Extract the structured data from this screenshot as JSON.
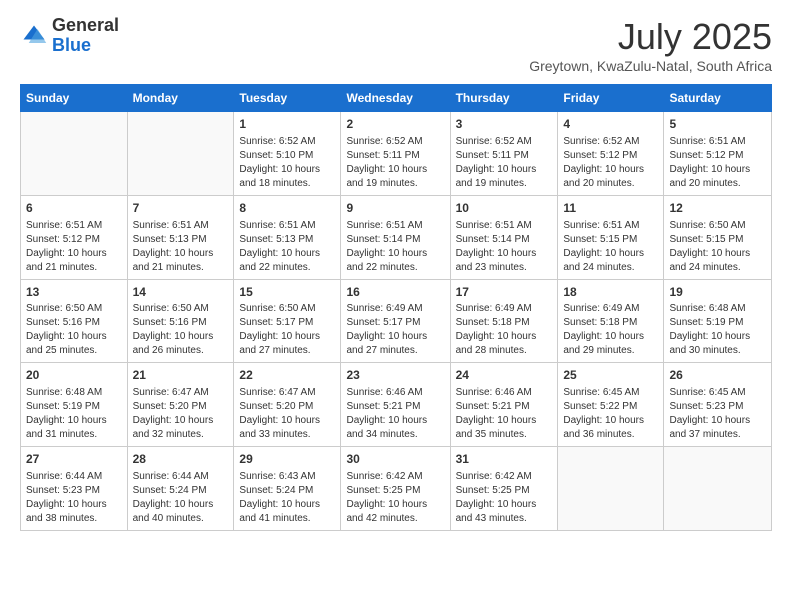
{
  "header": {
    "logo": {
      "general": "General",
      "blue": "Blue"
    },
    "title": "July 2025",
    "location": "Greytown, KwaZulu-Natal, South Africa"
  },
  "calendar": {
    "columns": [
      "Sunday",
      "Monday",
      "Tuesday",
      "Wednesday",
      "Thursday",
      "Friday",
      "Saturday"
    ],
    "rows": [
      [
        {
          "day": "",
          "info": ""
        },
        {
          "day": "",
          "info": ""
        },
        {
          "day": "1",
          "info": "Sunrise: 6:52 AM\nSunset: 5:10 PM\nDaylight: 10 hours and 18 minutes."
        },
        {
          "day": "2",
          "info": "Sunrise: 6:52 AM\nSunset: 5:11 PM\nDaylight: 10 hours and 19 minutes."
        },
        {
          "day": "3",
          "info": "Sunrise: 6:52 AM\nSunset: 5:11 PM\nDaylight: 10 hours and 19 minutes."
        },
        {
          "day": "4",
          "info": "Sunrise: 6:52 AM\nSunset: 5:12 PM\nDaylight: 10 hours and 20 minutes."
        },
        {
          "day": "5",
          "info": "Sunrise: 6:51 AM\nSunset: 5:12 PM\nDaylight: 10 hours and 20 minutes."
        }
      ],
      [
        {
          "day": "6",
          "info": "Sunrise: 6:51 AM\nSunset: 5:12 PM\nDaylight: 10 hours and 21 minutes."
        },
        {
          "day": "7",
          "info": "Sunrise: 6:51 AM\nSunset: 5:13 PM\nDaylight: 10 hours and 21 minutes."
        },
        {
          "day": "8",
          "info": "Sunrise: 6:51 AM\nSunset: 5:13 PM\nDaylight: 10 hours and 22 minutes."
        },
        {
          "day": "9",
          "info": "Sunrise: 6:51 AM\nSunset: 5:14 PM\nDaylight: 10 hours and 22 minutes."
        },
        {
          "day": "10",
          "info": "Sunrise: 6:51 AM\nSunset: 5:14 PM\nDaylight: 10 hours and 23 minutes."
        },
        {
          "day": "11",
          "info": "Sunrise: 6:51 AM\nSunset: 5:15 PM\nDaylight: 10 hours and 24 minutes."
        },
        {
          "day": "12",
          "info": "Sunrise: 6:50 AM\nSunset: 5:15 PM\nDaylight: 10 hours and 24 minutes."
        }
      ],
      [
        {
          "day": "13",
          "info": "Sunrise: 6:50 AM\nSunset: 5:16 PM\nDaylight: 10 hours and 25 minutes."
        },
        {
          "day": "14",
          "info": "Sunrise: 6:50 AM\nSunset: 5:16 PM\nDaylight: 10 hours and 26 minutes."
        },
        {
          "day": "15",
          "info": "Sunrise: 6:50 AM\nSunset: 5:17 PM\nDaylight: 10 hours and 27 minutes."
        },
        {
          "day": "16",
          "info": "Sunrise: 6:49 AM\nSunset: 5:17 PM\nDaylight: 10 hours and 27 minutes."
        },
        {
          "day": "17",
          "info": "Sunrise: 6:49 AM\nSunset: 5:18 PM\nDaylight: 10 hours and 28 minutes."
        },
        {
          "day": "18",
          "info": "Sunrise: 6:49 AM\nSunset: 5:18 PM\nDaylight: 10 hours and 29 minutes."
        },
        {
          "day": "19",
          "info": "Sunrise: 6:48 AM\nSunset: 5:19 PM\nDaylight: 10 hours and 30 minutes."
        }
      ],
      [
        {
          "day": "20",
          "info": "Sunrise: 6:48 AM\nSunset: 5:19 PM\nDaylight: 10 hours and 31 minutes."
        },
        {
          "day": "21",
          "info": "Sunrise: 6:47 AM\nSunset: 5:20 PM\nDaylight: 10 hours and 32 minutes."
        },
        {
          "day": "22",
          "info": "Sunrise: 6:47 AM\nSunset: 5:20 PM\nDaylight: 10 hours and 33 minutes."
        },
        {
          "day": "23",
          "info": "Sunrise: 6:46 AM\nSunset: 5:21 PM\nDaylight: 10 hours and 34 minutes."
        },
        {
          "day": "24",
          "info": "Sunrise: 6:46 AM\nSunset: 5:21 PM\nDaylight: 10 hours and 35 minutes."
        },
        {
          "day": "25",
          "info": "Sunrise: 6:45 AM\nSunset: 5:22 PM\nDaylight: 10 hours and 36 minutes."
        },
        {
          "day": "26",
          "info": "Sunrise: 6:45 AM\nSunset: 5:23 PM\nDaylight: 10 hours and 37 minutes."
        }
      ],
      [
        {
          "day": "27",
          "info": "Sunrise: 6:44 AM\nSunset: 5:23 PM\nDaylight: 10 hours and 38 minutes."
        },
        {
          "day": "28",
          "info": "Sunrise: 6:44 AM\nSunset: 5:24 PM\nDaylight: 10 hours and 40 minutes."
        },
        {
          "day": "29",
          "info": "Sunrise: 6:43 AM\nSunset: 5:24 PM\nDaylight: 10 hours and 41 minutes."
        },
        {
          "day": "30",
          "info": "Sunrise: 6:42 AM\nSunset: 5:25 PM\nDaylight: 10 hours and 42 minutes."
        },
        {
          "day": "31",
          "info": "Sunrise: 6:42 AM\nSunset: 5:25 PM\nDaylight: 10 hours and 43 minutes."
        },
        {
          "day": "",
          "info": ""
        },
        {
          "day": "",
          "info": ""
        }
      ]
    ]
  }
}
